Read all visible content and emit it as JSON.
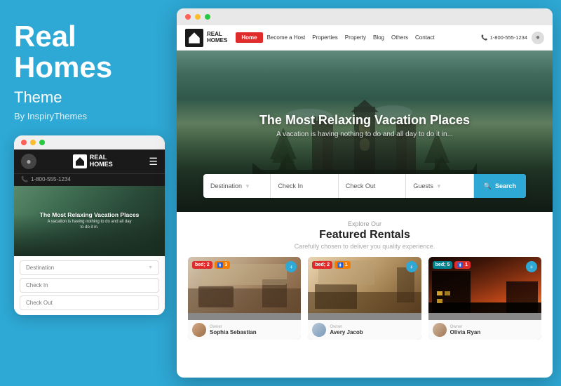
{
  "left": {
    "title_line1": "Real",
    "title_line2": "Homes",
    "subtitle": "Theme",
    "author": "By InspiryThemes",
    "mobile_logo": "REAL\nHOMES",
    "mobile_phone": "1-800-555-1234",
    "hero_title": "The Most Relaxing Vacation Places",
    "hero_sub": "A vacation is having nothing to do and all day\nto do it in.",
    "search_dest": "Destination",
    "search_checkin": "Check In",
    "search_checkout": "Check Out"
  },
  "right": {
    "nav": {
      "logo_text": "REAL\nHOMES",
      "home": "Home",
      "become": "Become a Host",
      "properties": "Properties",
      "property": "Property",
      "blog": "Blog",
      "others": "Others",
      "contact": "Contact",
      "phone": "1-800-555-1234"
    },
    "hero": {
      "title": "The Most Relaxing Vacation Places",
      "subtitle": "A vacation is having nothing to do and all day to do it in..."
    },
    "search": {
      "destination": "Destination",
      "checkin": "Check In",
      "checkout": "Check Out",
      "guests": "Guests",
      "btn": "Search"
    },
    "featured": {
      "explore": "Explore Our",
      "title": "Featured Rentals",
      "desc": "Carefully chosen to deliver you quality experience.",
      "cards": [
        {
          "badge1": "2",
          "badge2": "3",
          "owner_label": "Owner",
          "owner_name": "Sophia Sebastian",
          "type": "interior"
        },
        {
          "badge1": "2",
          "badge2": "1",
          "owner_label": "Owner",
          "owner_name": "Avery Jacob",
          "type": "interior2"
        },
        {
          "badge1": "5",
          "badge2": "1",
          "owner_label": "Owner",
          "owner_name": "Olivia Ryan",
          "type": "exterior"
        }
      ]
    }
  },
  "dots": {
    "red": "#ff5f57",
    "yellow": "#febc2e",
    "green": "#28c840"
  }
}
